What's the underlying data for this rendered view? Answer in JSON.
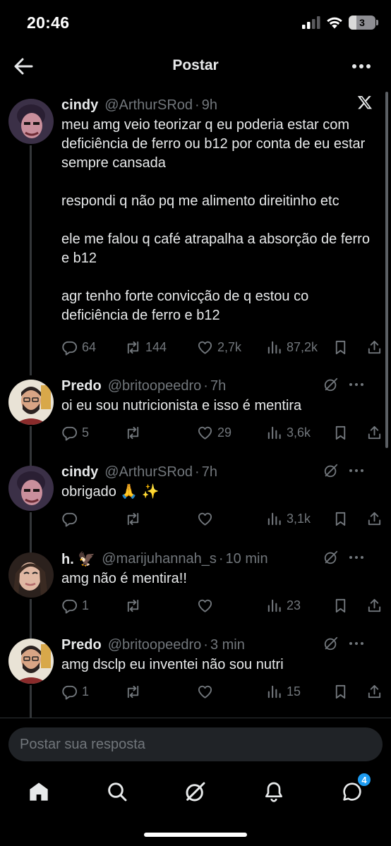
{
  "status_bar": {
    "time": "20:46",
    "battery": "3",
    "battery_level": 0.3
  },
  "header": {
    "title": "Postar"
  },
  "posts": [
    {
      "name": "cindy",
      "handle": "@ArthurSRod",
      "time": "9h",
      "paragraphs": [
        "meu amg veio teorizar q eu poderia estar com deficiência de ferro ou b12 por conta de eu estar sempre cansada",
        "respondi q não pq me alimento direitinho etc",
        "ele me falou q café atrapalha a absorção de ferro e b12",
        "agr tenho forte convicção de q estou co deficiência de ferro e b12"
      ],
      "replies": "64",
      "reposts": "144",
      "likes": "2,7k",
      "views": "87,2k",
      "header_icon": "x-logo-icon"
    },
    {
      "name": "Predo",
      "handle": "@britoopeedro",
      "time": "7h",
      "paragraphs": [
        "oi eu sou nutricionista e isso é mentira"
      ],
      "replies": "5",
      "reposts": "",
      "likes": "29",
      "views": "3,6k",
      "header_icon": "grok-icon"
    },
    {
      "name": "cindy",
      "handle": "@ArthurSRod",
      "time": "7h",
      "paragraphs": [
        "obrigado 🙏 ✨"
      ],
      "replies": "",
      "reposts": "",
      "likes": "",
      "views": "3,1k",
      "header_icon": "grok-icon"
    },
    {
      "name": "h. 🦅",
      "handle": "@marijuhannah_s",
      "time": "10 min",
      "paragraphs": [
        "amg não é mentira!!"
      ],
      "replies": "1",
      "reposts": "",
      "likes": "",
      "views": "23",
      "header_icon": "grok-icon"
    },
    {
      "name": "Predo",
      "handle": "@britoopeedro",
      "time": "3 min",
      "paragraphs": [
        "amg dsclp eu inventei não sou nutri"
      ],
      "replies": "1",
      "reposts": "",
      "likes": "",
      "views": "15",
      "header_icon": "grok-icon"
    }
  ],
  "reply_bar": {
    "placeholder": "Postar sua resposta"
  },
  "tab_bar": {
    "messages_badge": "4"
  },
  "colors": {
    "background": "#000000",
    "text": "#e7e9ea",
    "muted": "#71767b",
    "accent": "#1d9bf0",
    "divider": "#2f3336"
  }
}
